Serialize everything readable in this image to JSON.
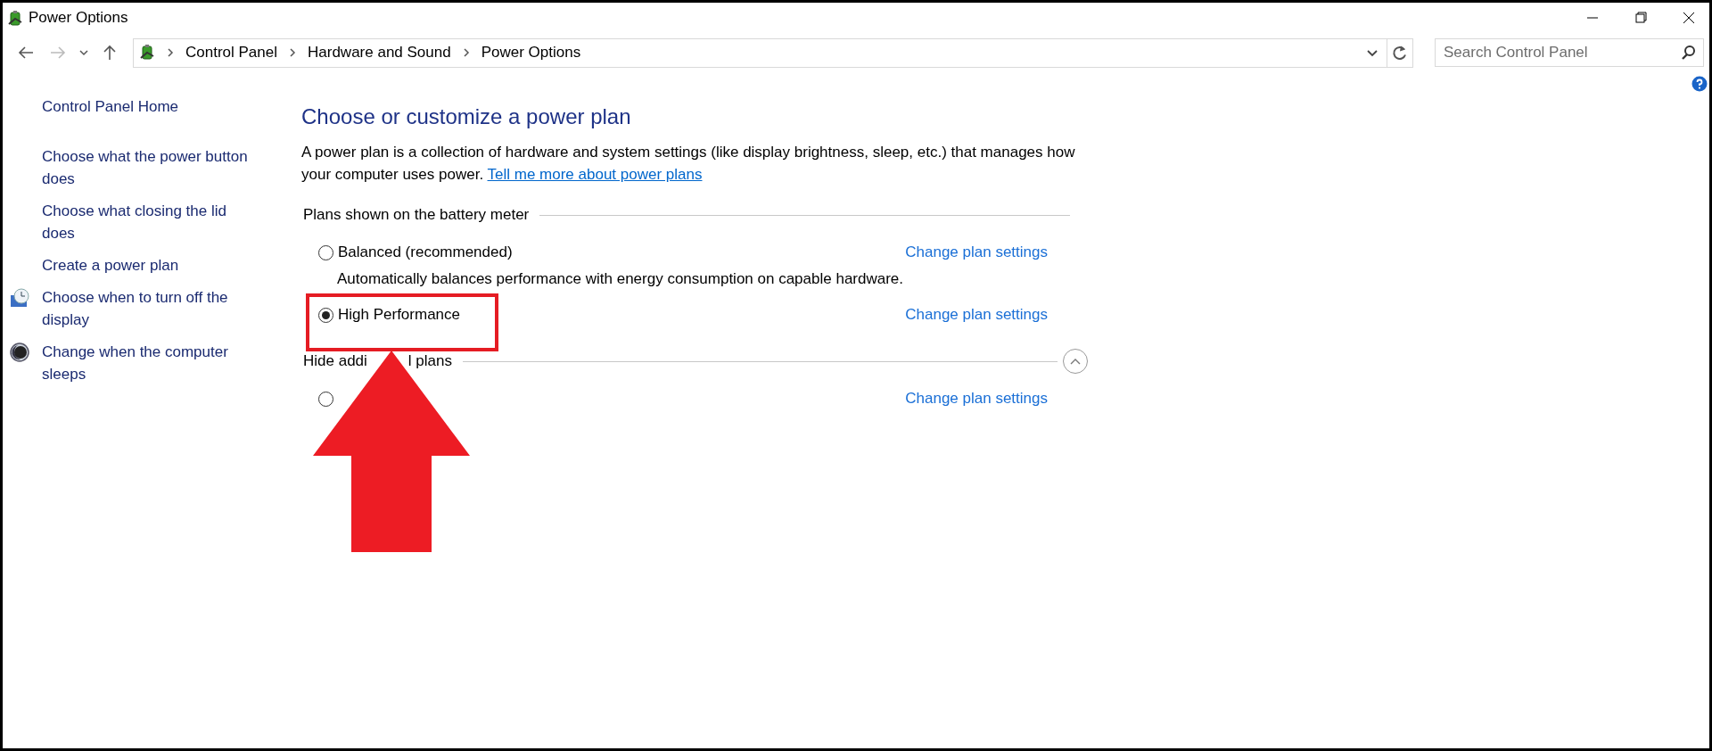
{
  "window": {
    "title": "Power Options"
  },
  "address_bar": {
    "breadcrumb": [
      "Control Panel",
      "Hardware and Sound",
      "Power Options"
    ],
    "search": {
      "placeholder": "Search Control Panel"
    }
  },
  "sidebar": {
    "home": "Control Panel Home",
    "links": [
      {
        "label": "Choose what the power button does",
        "kind": "text"
      },
      {
        "label": "Choose what closing the lid does",
        "kind": "text"
      },
      {
        "label": "Create a power plan",
        "kind": "text"
      },
      {
        "label": "Choose when to turn off the display",
        "kind": "display"
      },
      {
        "label": "Change when the computer sleeps",
        "kind": "sleep"
      }
    ]
  },
  "main": {
    "heading": "Choose or customize a power plan",
    "intro": {
      "text": "A power plan is a collection of hardware and system settings (like display brightness, sleep, etc.) that manages how your computer uses power.",
      "link": "Tell me more about power plans"
    },
    "sections": [
      {
        "label_parts": [
          "Plans shown on the battery meter"
        ],
        "plans": [
          {
            "name": "Balanced (recommended)",
            "description": "Automatically balances performance with energy consumption on capable hardware.",
            "selected": false,
            "highlighted": false,
            "link": "Change plan settings"
          },
          {
            "name": "High Performance",
            "selected": true,
            "highlighted": true,
            "link": "Change plan settings"
          }
        ]
      },
      {
        "label_parts": [
          "Hide addi",
          "l plans"
        ],
        "expanded": true,
        "plans": [
          {
            "selected": false,
            "highlighted": false,
            "link": "Change plan settings"
          }
        ]
      }
    ]
  }
}
